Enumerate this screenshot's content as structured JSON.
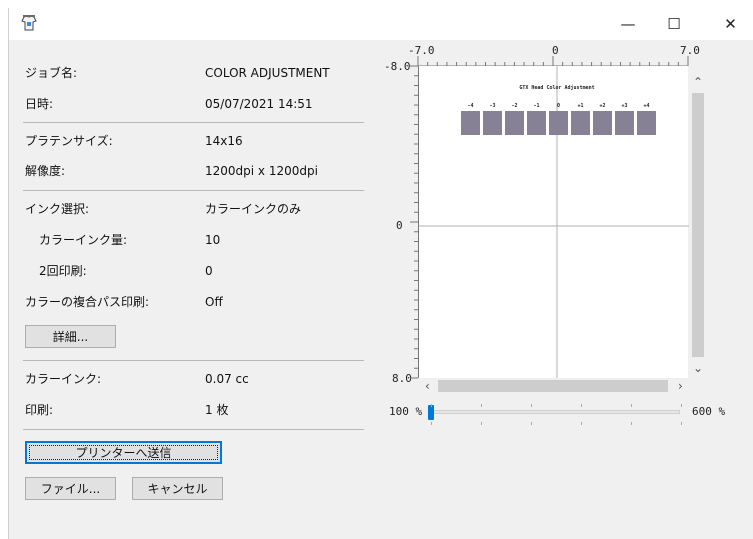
{
  "window": {
    "title": "",
    "minimize_glyph": "—",
    "maximize_glyph": "☐",
    "close_glyph": "✕",
    "app_icon": "printer-shirt-icon"
  },
  "job": {
    "name_label": "ジョブ名:",
    "name_value": "COLOR ADJUSTMENT",
    "datetime_label": "日時:",
    "datetime_value": "05/07/2021 14:51"
  },
  "platen": {
    "size_label": "プラテンサイズ:",
    "size_value": "14x16",
    "resolution_label": "解像度:",
    "resolution_value": "1200dpi x 1200dpi"
  },
  "ink": {
    "select_label": "インク選択:",
    "select_value": "カラーインクのみ",
    "color_amount_label": "カラーインク量:",
    "color_amount_value": "10",
    "double_print_label": "2回印刷:",
    "double_print_value": "0",
    "multipass_label": "カラーの複合パス印刷:",
    "multipass_value": "Off",
    "details_button": "詳細..."
  },
  "usage": {
    "color_ink_label": "カラーインク:",
    "color_ink_value": "0.07 cc",
    "print_label": "印刷:",
    "print_value": "1 枚"
  },
  "actions": {
    "send_button": "プリンターへ送信",
    "file_button": "ファイル...",
    "cancel_button": "キャンセル"
  },
  "preview": {
    "x_min": "-7.0",
    "x_mid": "0",
    "x_max": "7.0",
    "y_min": "-8.0",
    "y_mid": "0",
    "y_max": "8.0",
    "canvas_title": "GTX Head Color Adjustment",
    "swatch_labels": [
      "-4",
      "-3",
      "-2",
      "-1",
      "0",
      "+1",
      "+2",
      "+3",
      "+4"
    ],
    "swatch_color": "#868195",
    "zoom_min": "100 %",
    "zoom_max": "600 %",
    "zoom_value": 0
  }
}
